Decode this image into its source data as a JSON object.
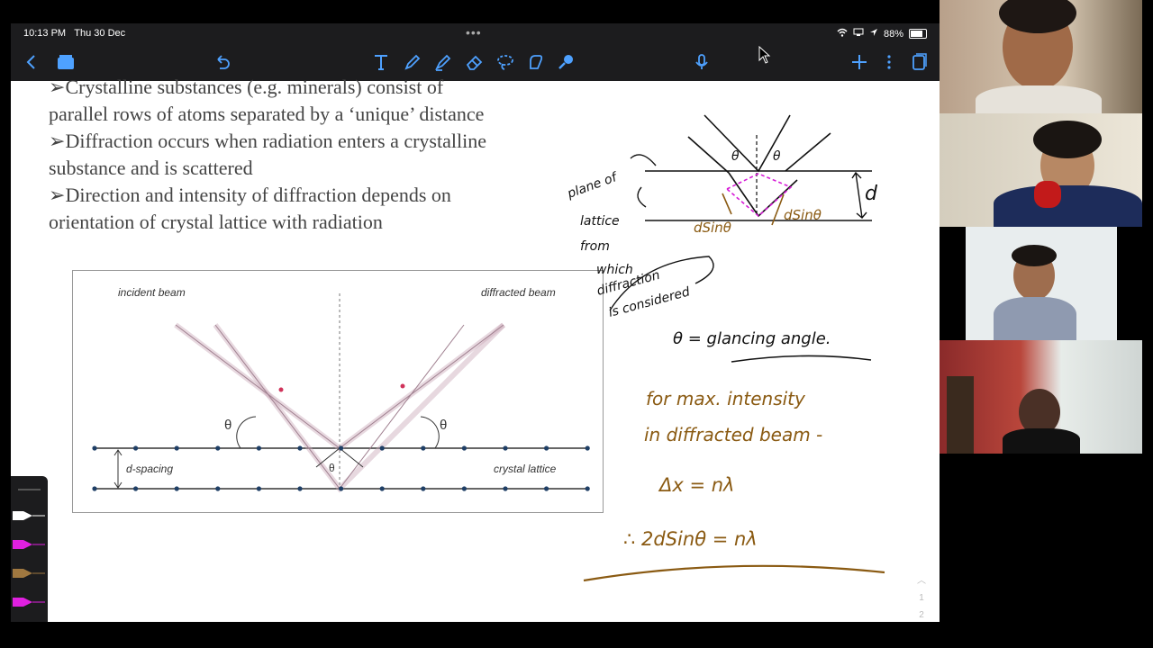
{
  "status_bar": {
    "time": "10:13 PM",
    "date": "Thu 30 Dec",
    "battery": "88%"
  },
  "toolbar": {
    "icons": [
      "back-icon",
      "documents-icon",
      "undo-icon",
      "text-tool-icon",
      "pen-icon",
      "highlighter-icon",
      "eraser-icon",
      "lasso-icon",
      "shapes-icon",
      "laser-pointer-icon",
      "microphone-icon",
      "add-page-icon",
      "more-icon",
      "pages-icon"
    ]
  },
  "slide": {
    "bullets": [
      {
        "marker": "➢",
        "line1": "Crystalline substances (e.g. minerals) consist of",
        "line2": "parallel rows of atoms separated by a ‘unique’ distance"
      },
      {
        "marker": "➢",
        "line1": "Diffraction occurs when radiation enters a crystalline",
        "line2": "substance and is scattered"
      },
      {
        "marker": "➢",
        "line1": "Direction and intensity of diffraction depends on",
        "line2": "orientation of crystal lattice with radiation"
      }
    ],
    "figure": {
      "incident_beam": "incident beam",
      "diffracted_beam": "diffracted beam",
      "theta": "θ",
      "d_spacing": "d-spacing",
      "crystal_lattice": "crystal lattice"
    }
  },
  "handwriting": {
    "plane_note": [
      "plane of",
      "lattice",
      "from",
      "which",
      "diffraction",
      "is considered"
    ],
    "d_label": "d",
    "dsin_left": "dSinθ",
    "dsin_right": "dSinθ",
    "theta_left": "θ",
    "theta_right": "θ",
    "glancing": "θ = glancing angle.",
    "max_intensity_1": "for max. intensity",
    "max_intensity_2": "in diffracted beam -",
    "delta_x": "Δx = nλ",
    "bragg": "∴ 2dSinθ = nλ"
  },
  "pager": {
    "page_current": "1",
    "page_total": "2"
  },
  "colors": {
    "ink_black": "#111111",
    "ink_brown": "#8a5a12",
    "ink_magenta": "#d61bd6",
    "accent_blue": "#4ea1ff"
  },
  "video_tiles": [
    "participant-1",
    "participant-2",
    "participant-3",
    "participant-4"
  ]
}
